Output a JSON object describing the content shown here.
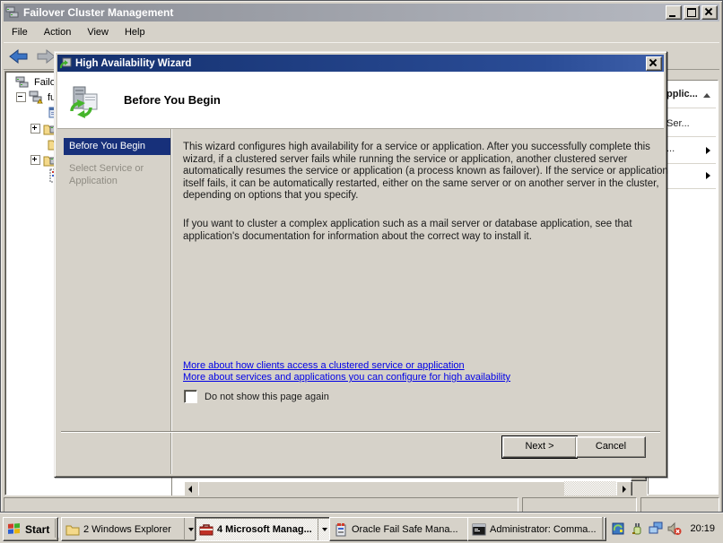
{
  "colors": {
    "window_face": "#d6d2c9",
    "dialog_title_bar": "#16316f",
    "inactive_title_bar": "#8b8e96",
    "selected_step_bg": "#17307a",
    "link_blue": "#0000e6"
  },
  "main_window": {
    "title": "Failover Cluster Management",
    "menu": [
      {
        "label": "File"
      },
      {
        "label": "Action"
      },
      {
        "label": "View"
      },
      {
        "label": "Help"
      }
    ],
    "tree": {
      "root_label": "Failov",
      "cluster_label": "fu"
    },
    "actions_pane": {
      "header": "pplic...",
      "item1": "Ser...",
      "item2": "..."
    }
  },
  "wizard": {
    "title": "High Availability Wizard",
    "page_heading": "Before You Begin",
    "steps": [
      {
        "label": "Before You Begin"
      },
      {
        "label": "Select Service or Application"
      }
    ],
    "paragraph1": "This wizard configures high availability for a service or application. After you successfully complete this wizard, if a clustered server fails while running the service or application, another clustered server automatically resumes the service or application (a process known as failover). If the service or application itself fails, it can be automatically restarted, either on the same server or on another server in the cluster, depending on options that you specify.",
    "paragraph2": "If you want to cluster a complex application such as a mail server or database application, see that application's documentation for information about the correct way to install it.",
    "link1": "More about how clients access a clustered service or application",
    "link2": "More about services and applications you can configure for high availability",
    "checkbox_label": "Do not show this page again",
    "next_label": "Next >",
    "cancel_label": "Cancel"
  },
  "taskbar": {
    "start_label": "Start",
    "buttons": [
      {
        "label": "2 Windows Explorer"
      },
      {
        "label": "4 Microsoft Manag..."
      },
      {
        "label": "Oracle Fail Safe Mana..."
      },
      {
        "label": "Administrator: Comma..."
      }
    ],
    "clock": "20:19"
  }
}
